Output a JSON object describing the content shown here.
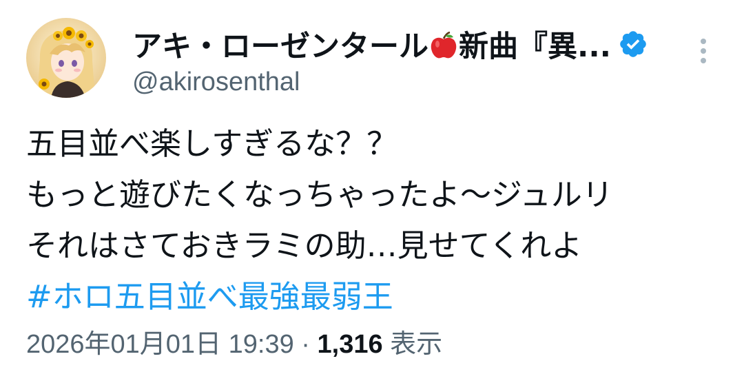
{
  "author": {
    "display_name_part1": "アキ・ローゼンタール",
    "name_emoji": "apple-icon",
    "display_name_part2": "新曲『異...",
    "handle": "@akirosenthal",
    "verified_badge": "verified-badge-icon",
    "badge_color": "#1d9bf0"
  },
  "tweet": {
    "lines": [
      "五目並べ楽しすぎるな？？",
      "もっと遊びたくなっちゃったよ～ジュルリ",
      "それはさておきラミの助…見せてくれよ"
    ],
    "hashtag": "#ホロ五目並べ最強最弱王",
    "hashtag_color": "#1d9bf0"
  },
  "meta": {
    "timestamp": "2026年01月01日 19:39",
    "separator": "·",
    "views_count": "1,316",
    "views_label": "表示"
  },
  "more_menu": "more-options-icon"
}
